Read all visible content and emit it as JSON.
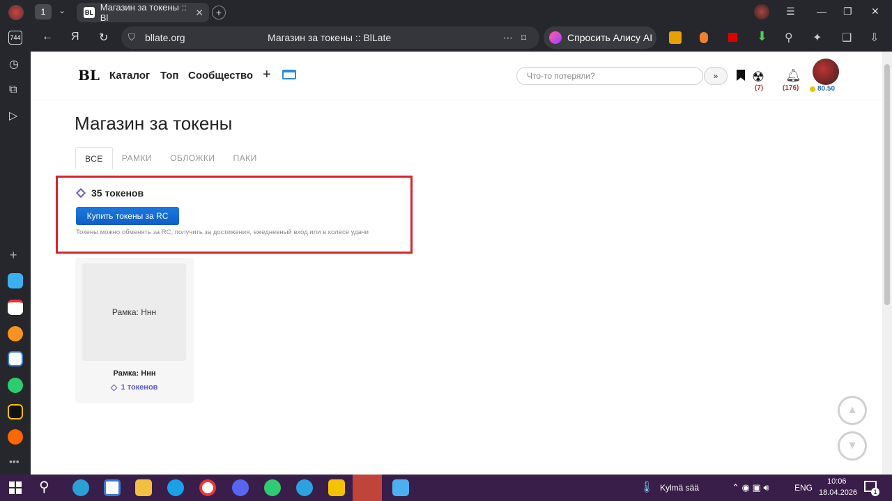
{
  "browser": {
    "tab_count": "1",
    "tab_title": "Магазин за токены :: Bl",
    "sidebar_counter": "744",
    "url": "bllate.org",
    "page_title": "Магазин за токены :: BlLate",
    "alice_label": "Спросить Алису AI"
  },
  "site": {
    "logo": "BL",
    "nav": [
      "Каталог",
      "Топ",
      "Сообщество"
    ],
    "search_placeholder": "Что-то потеряли?",
    "search_go": "»",
    "notif_count_1": "(7)",
    "notif_count_2": "(176)",
    "balance": "80.50"
  },
  "main": {
    "title": "Магазин за токены",
    "tabs": [
      "ВСЕ",
      "РАМКИ",
      "ОБЛОЖКИ",
      "ПАКИ"
    ],
    "tokens": "35 токенов",
    "buy_button": "Купить токены за RC",
    "note": "Токены можно обменять за RC, получить за достижения, ежедневный вход или в колесе удачи",
    "card": {
      "image_alt": "Рамка: Ннн",
      "title": "Рамка: Ннн",
      "price": "1 токенов"
    }
  },
  "taskbar": {
    "weather": "Kylmä sää",
    "lang": "ENG",
    "time": "10:06",
    "date": "18.04.2026",
    "notifications": "1"
  }
}
